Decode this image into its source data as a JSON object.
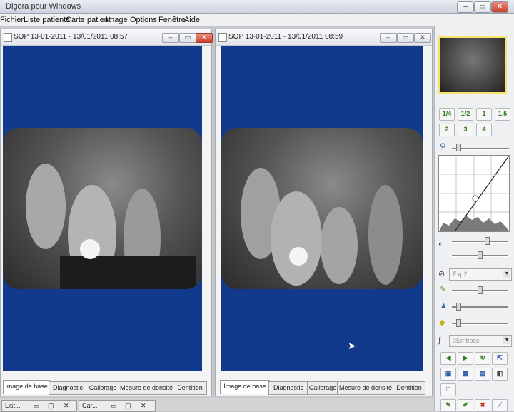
{
  "app": {
    "title": "Digora pour Windows"
  },
  "window_controls": {
    "minimize": "–",
    "restore": "▭",
    "close": "✕"
  },
  "menu": [
    "Fichier",
    "Liste patients",
    "Carte patient",
    "Image",
    "Options",
    "Fenêtre",
    "Aide"
  ],
  "windows": [
    {
      "title": "SOP 13-01-2011 - 13/01/2011 08:57",
      "tabs": [
        "Image de base",
        "Diagnostic",
        "Calibrage",
        "Mesure de densité",
        "Dentition"
      ],
      "selected_tab": "Image de base"
    },
    {
      "title": "SOP 13-01-2011 - 13/01/2011 08:59",
      "tabs": [
        "Image de base",
        "Diagnostic",
        "Calibrage",
        "Mesure de densité",
        "Dentition"
      ],
      "selected_tab": "Image de base"
    }
  ],
  "panel": {
    "zoom_buttons": [
      "1/4",
      "1/2",
      "1",
      "1.5",
      "2",
      "3",
      "4"
    ],
    "filter_combo": "Exp2",
    "emboss_combo": "3Emboss"
  },
  "taskbar": [
    {
      "label": "List..."
    },
    {
      "label": "Car..."
    }
  ],
  "colors": {
    "canvas_blue": "#123a8c",
    "tab_selected": "#ffffff",
    "accent_green": "#2f7a1c"
  },
  "icons": [
    "zoom-icon",
    "contrast-icon",
    "filter-icon",
    "brightness-icon",
    "sharpen-icon",
    "color-icon",
    "emboss-icon",
    "undo-icon",
    "redo-icon",
    "refresh-icon",
    "export-icon",
    "select-icon",
    "crop-icon",
    "pen-icon",
    "marker-icon"
  ]
}
